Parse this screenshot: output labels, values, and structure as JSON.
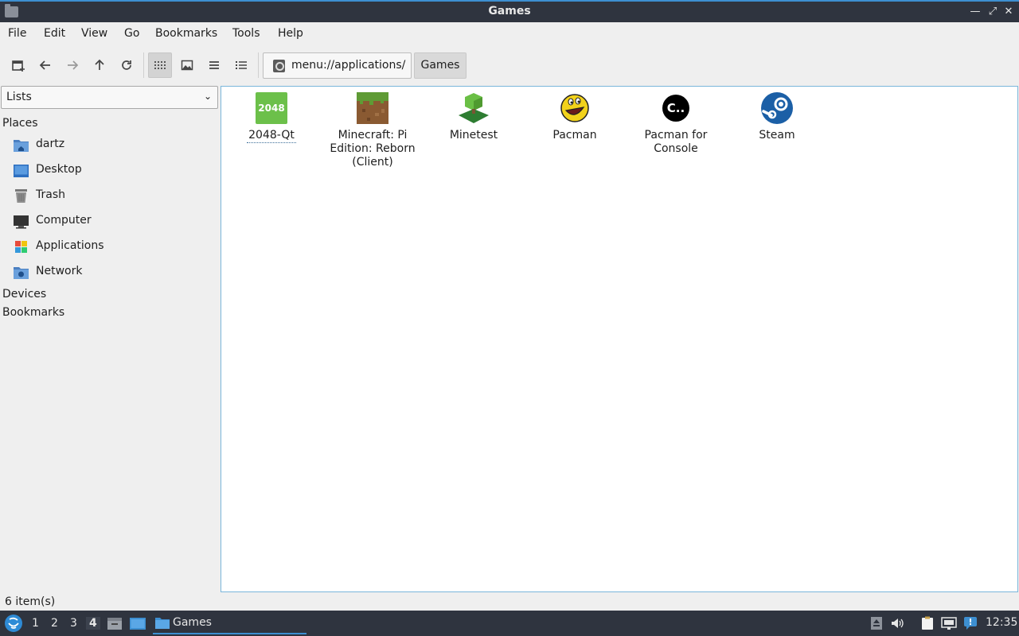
{
  "window": {
    "title": "Games"
  },
  "menu": [
    "File",
    "Edit",
    "View",
    "Go",
    "Bookmarks",
    "Tools",
    "Help"
  ],
  "toolbar": {
    "path": "menu://applications/",
    "crumb": "Games"
  },
  "sidebar": {
    "mode": "Lists",
    "places_header": "Places",
    "places": [
      "dartz",
      "Desktop",
      "Trash",
      "Computer",
      "Applications",
      "Network"
    ],
    "devices_header": "Devices",
    "bookmarks_header": "Bookmarks"
  },
  "items": [
    {
      "label": "2048-Qt",
      "icon_text": "2048",
      "icon": "2048-icon"
    },
    {
      "label": "Minecraft: Pi Edition: Reborn (Client)",
      "icon": "minecraft-grass-block-icon"
    },
    {
      "label": "Minetest",
      "icon": "minetest-icon"
    },
    {
      "label": "Pacman",
      "icon": "pacman-icon"
    },
    {
      "label": "Pacman for Console",
      "icon_text": "C..",
      "icon": "console-icon"
    },
    {
      "label": "Steam",
      "icon": "steam-icon"
    }
  ],
  "status": "6 item(s)",
  "taskbar": {
    "desktops": [
      "1",
      "2",
      "3",
      "4"
    ],
    "active_desktop": "4",
    "app": "Games",
    "clock": "12:35"
  },
  "colors": {
    "accent": "#3d8fd1",
    "titlebar": "#2f343f",
    "selection_border": "#7ab6da"
  }
}
